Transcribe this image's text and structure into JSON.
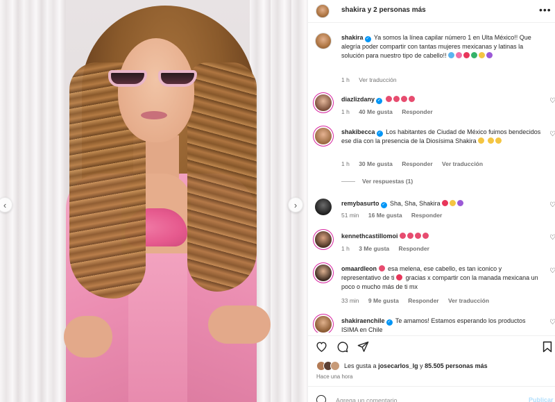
{
  "header": {
    "title": "shakira y 2 personas más",
    "more_icon": "more-horizontal-icon"
  },
  "caption": {
    "user": "shakira",
    "text": "Ya somos la línea capilar número 1 en Ulta México!! Que alegría poder compartir con tantas mujeres mexicanas y latinas la solución para nuestro tipo de cabello!!",
    "time": "1 h",
    "translate": "Ver traducción",
    "emoji_colors": [
      "#5ab4f0",
      "#f06fa8",
      "#e8365a",
      "#34b36a",
      "#f4c542",
      "#9b59d6"
    ]
  },
  "comments": [
    {
      "user": "diazlizdany",
      "text": "",
      "emoji_colors": [
        "#e74c6f",
        "#e74c6f",
        "#e74c6f",
        "#e74c6f"
      ],
      "time": "1 h",
      "likes": "40 Me gusta",
      "reply": "Responder",
      "translate": ""
    },
    {
      "user": "shakibecca",
      "text": "Los habitantes de Ciudad de México fuimos bendecidos ese día con la presencia de la Diosísima Shakira",
      "emoji_colors": [
        "#f4c542",
        "#f4c542",
        "#f4c542"
      ],
      "time": "1 h",
      "likes": "30 Me gusta",
      "reply": "Responder",
      "translate": "Ver traducción",
      "view_replies": "Ver respuestas (1)"
    },
    {
      "user": "remybasurto",
      "text": "Sha, Sha, Shakira",
      "emoji_colors": [
        "#e8365a",
        "#f4c542",
        "#9b59d6"
      ],
      "time": "51 min",
      "likes": "16 Me gusta",
      "reply": "Responder",
      "translate": ""
    },
    {
      "user": "kennethcastillomoi",
      "text": "",
      "emoji_colors": [
        "#e74c6f",
        "#e74c6f",
        "#e74c6f",
        "#e74c6f"
      ],
      "time": "1 h",
      "likes": "3 Me gusta",
      "reply": "Responder",
      "translate": ""
    },
    {
      "user": "omaardleon",
      "text_a": "esa melena, ese cabello, es tan iconico y representativo de ti",
      "text_b": "gracias x compartir con la manada mexicana un poco o mucho más de ti mx",
      "emoji_colors": [
        "#e74c6f",
        "#e8365a"
      ],
      "time": "33 min",
      "likes": "9 Me gusta",
      "reply": "Responder",
      "translate": "Ver traducción"
    },
    {
      "user": "shakiraenchile",
      "text": "Te amamos! Estamos esperando los productos ISIMA en Chile",
      "emoji_colors": [
        "#f4c542"
      ],
      "time": "",
      "likes": "",
      "reply": "",
      "translate": ""
    }
  ],
  "actions": {
    "like_icon": "heart-outline-icon",
    "comment_icon": "comment-icon",
    "share_icon": "send-icon",
    "save_icon": "bookmark-icon"
  },
  "likes": {
    "prefix": "Les gusta a",
    "user": "josecarlos_lg",
    "middle": "y",
    "count": "85.505 personas más"
  },
  "posted": "Hace una hora",
  "add_comment": {
    "placeholder": "Agrega un comentario...",
    "publish": "Publicar"
  },
  "photo": {
    "prev_icon": "chevron-left-icon",
    "next_icon": "chevron-right-icon"
  },
  "colors": {
    "accent": "#0095f6",
    "muted": "#737373",
    "verified": "#0095f6",
    "publish_disabled": "#b2dffc"
  }
}
